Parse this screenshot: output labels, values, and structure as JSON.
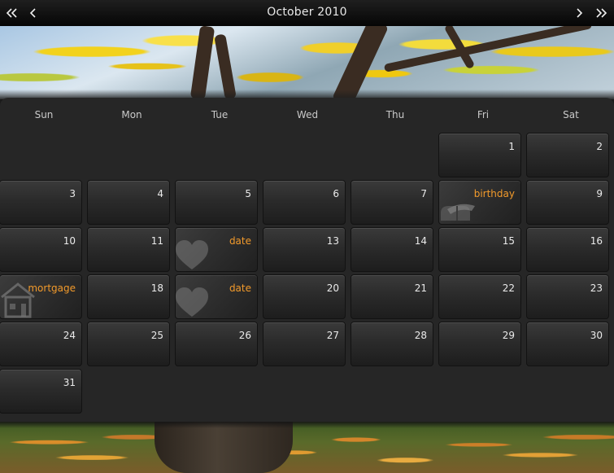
{
  "header": {
    "title": "October 2010",
    "prev_year_icon": "double-chevron-left-icon",
    "prev_month_icon": "chevron-left-icon",
    "next_month_icon": "chevron-right-icon",
    "next_year_icon": "double-chevron-right-icon"
  },
  "weekdays": [
    "Sun",
    "Mon",
    "Tue",
    "Wed",
    "Thu",
    "Fri",
    "Sat"
  ],
  "days": [
    {
      "label": "1"
    },
    {
      "label": "2"
    },
    {
      "label": "3"
    },
    {
      "label": "4"
    },
    {
      "label": "5"
    },
    {
      "label": "6"
    },
    {
      "label": "7"
    },
    {
      "label": "birthday",
      "event": true,
      "icon": "gift-icon"
    },
    {
      "label": "9"
    },
    {
      "label": "10"
    },
    {
      "label": "11"
    },
    {
      "label": "date",
      "event": true,
      "icon": "heart-icon"
    },
    {
      "label": "13"
    },
    {
      "label": "14"
    },
    {
      "label": "15"
    },
    {
      "label": "16"
    },
    {
      "label": "mortgage",
      "event": true,
      "icon": "house-icon"
    },
    {
      "label": "18"
    },
    {
      "label": "date",
      "event": true,
      "icon": "heart-icon"
    },
    {
      "label": "20"
    },
    {
      "label": "21"
    },
    {
      "label": "22"
    },
    {
      "label": "23"
    },
    {
      "label": "24"
    },
    {
      "label": "25"
    },
    {
      "label": "26"
    },
    {
      "label": "27"
    },
    {
      "label": "28"
    },
    {
      "label": "29"
    },
    {
      "label": "30"
    },
    {
      "label": "31"
    }
  ],
  "colors": {
    "event_text": "#f29a2b",
    "day_text": "#eaeaea",
    "panel": "#262626"
  }
}
